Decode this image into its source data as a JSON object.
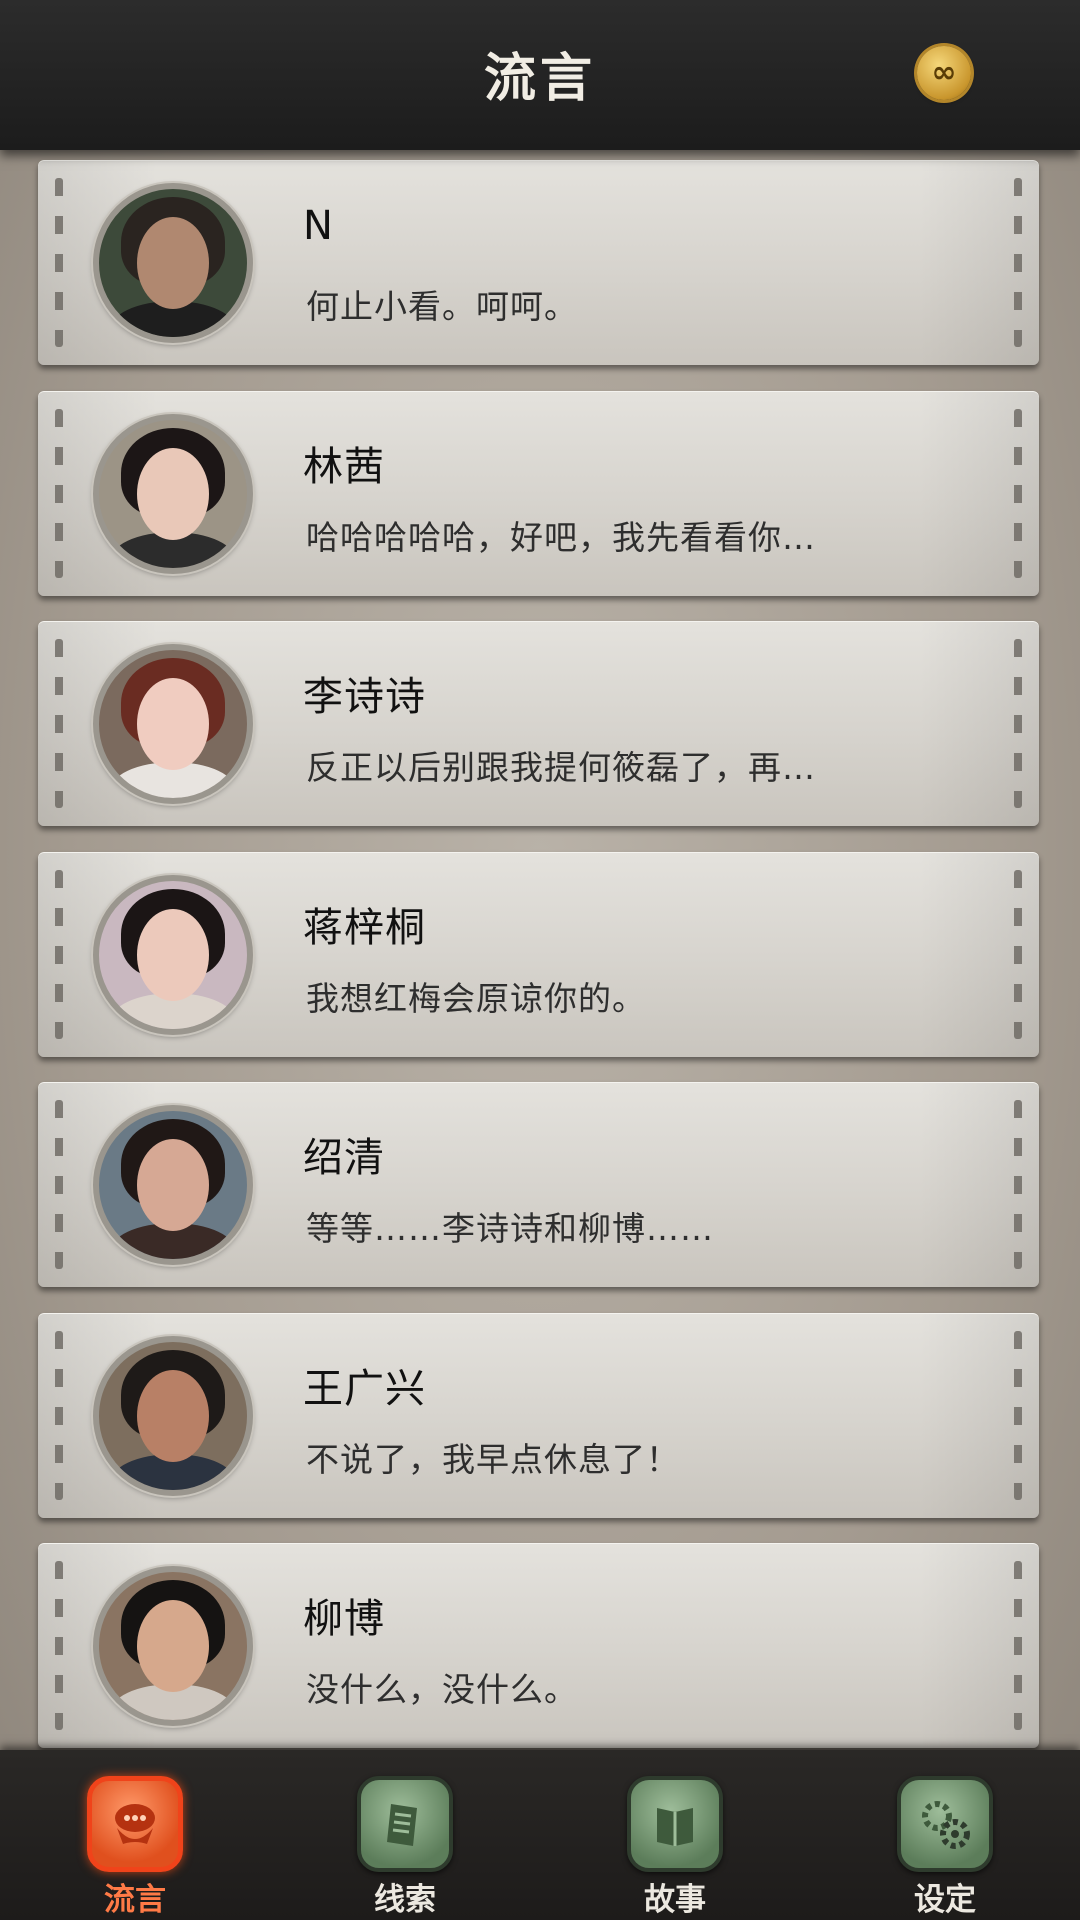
{
  "header": {
    "title": "流言",
    "badge_symbol": "∞"
  },
  "contacts": [
    {
      "name": "N",
      "message": "何止小看。呵呵。",
      "skin": "#b08870",
      "hair": "#2a2420",
      "shirt": "#1e1e1e",
      "bg": "#3d4a3a"
    },
    {
      "name": "林茜",
      "message": "哈哈哈哈哈，好吧，我先看看你…",
      "skin": "#e9c8b8",
      "hair": "#1c1616",
      "shirt": "#2c2c2c",
      "bg": "#9c9486"
    },
    {
      "name": "李诗诗",
      "message": "反正以后别跟我提何筱磊了，再…",
      "skin": "#f0ccc0",
      "hair": "#6a2c22",
      "shirt": "#e8e4e0",
      "bg": "#7b6a5e"
    },
    {
      "name": "蒋梓桐",
      "message": "我想红梅会原谅你的。",
      "skin": "#ecc9bb",
      "hair": "#1b1515",
      "shirt": "#dcd4cc",
      "bg": "#c9b8c0"
    },
    {
      "name": "绍清",
      "message": "等等……李诗诗和柳博……",
      "skin": "#d6a894",
      "hair": "#201816",
      "shirt": "#3a2a26",
      "bg": "#6a7a86"
    },
    {
      "name": "王广兴",
      "message": "不说了，我早点休息了！",
      "skin": "#b88066",
      "hair": "#1e1a18",
      "shirt": "#2b3340",
      "bg": "#7d6e5e"
    },
    {
      "name": "柳博",
      "message": "没什么，没什么。",
      "skin": "#d6a88c",
      "hair": "#151312",
      "shirt": "#cfc8c0",
      "bg": "#8a7462"
    }
  ],
  "tabs": [
    {
      "label": "流言",
      "icon": "chat-bubble-icon",
      "active": true
    },
    {
      "label": "线索",
      "icon": "document-icon",
      "active": false
    },
    {
      "label": "故事",
      "icon": "book-icon",
      "active": false
    },
    {
      "label": "设定",
      "icon": "gears-icon",
      "active": false
    }
  ]
}
